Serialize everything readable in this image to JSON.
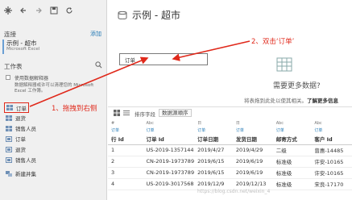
{
  "toolbar": {
    "icons": [
      "tableau-logo-icon",
      "back-arrow-icon",
      "forward-arrow-icon",
      "save-icon",
      "refresh-icon"
    ]
  },
  "connections": {
    "title": "连接",
    "add_label": "添加",
    "items": [
      {
        "name": "示例 - 超市",
        "type": "Microsoft Excel"
      }
    ]
  },
  "worksheets": {
    "title": "工作表",
    "interpreter_label": "使用数据解释器",
    "interpreter_desc": "数据解释器或许可以清理您的 Microsoft Excel 工作簿。",
    "sheets": [
      {
        "label": "订单",
        "icon": "sheet-icon"
      },
      {
        "label": "退货",
        "icon": "sheet-icon"
      },
      {
        "label": "销售人员",
        "icon": "sheet-icon"
      },
      {
        "label": "订单",
        "icon": "named-range-icon"
      },
      {
        "label": "退货",
        "icon": "named-range-icon"
      },
      {
        "label": "销售人员",
        "icon": "named-range-icon"
      }
    ],
    "new_union": "新建并集"
  },
  "datasource": {
    "title": "示例 - 超市"
  },
  "canvas": {
    "table_label": "订单",
    "annotation_drag": "1、拖拽到右侧",
    "annotation_dblclick": "2、双击‘订单’",
    "need_more_data": "需要更多数据?",
    "need_more_desc": "将表拖到此处以使其相关。",
    "learn_more": "了解更多信息"
  },
  "grid_toolbar": {
    "sort_label": "排序字段",
    "sort_value": "数据源顺序"
  },
  "grid": {
    "columns": [
      {
        "type": "#",
        "source": "订单",
        "name": "行 Id"
      },
      {
        "type": "Abc",
        "source": "订单",
        "name": "订单 Id"
      },
      {
        "type": "日",
        "source": "订单",
        "name": "订单日期"
      },
      {
        "type": "日",
        "source": "订单",
        "name": "发货日期"
      },
      {
        "type": "Abc",
        "source": "订单",
        "name": "邮寄方式"
      },
      {
        "type": "Abc",
        "source": "订单",
        "name": "客户 Id"
      }
    ],
    "rows": [
      [
        "1",
        "US-2019-1357144",
        "2019/4/27",
        "2019/4/29",
        "二级",
        "曾惠-14485"
      ],
      [
        "2",
        "CN-2019-1973789",
        "2019/6/15",
        "2019/6/19",
        "标准级",
        "许安-10165"
      ],
      [
        "3",
        "CN-2019-1973789",
        "2019/6/15",
        "2019/6/19",
        "标准级",
        "许安-10165"
      ],
      [
        "4",
        "US-2019-3017568",
        "2019/12/9",
        "2019/12/13",
        "标准级",
        "宋良-17170"
      ]
    ]
  },
  "watermark": "https://blog.csdn.net/weixin_4",
  "colors": {
    "annotation": "#e0291b",
    "accent": "#1f77b4",
    "connection_bar": "#6a9fd4"
  }
}
